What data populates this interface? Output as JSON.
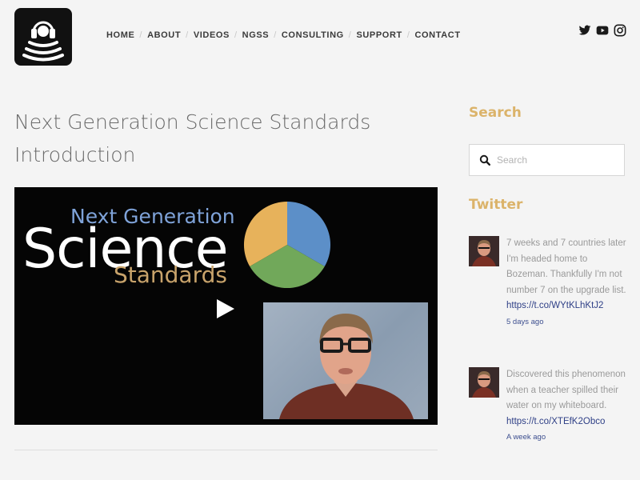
{
  "header": {
    "logo_icon": "headphones-signal-logo",
    "nav": [
      "HOME",
      "ABOUT",
      "VIDEOS",
      "NGSS",
      "CONSULTING",
      "SUPPORT",
      "CONTACT"
    ],
    "social_icons": [
      "twitter-icon",
      "youtube-icon",
      "instagram-icon"
    ]
  },
  "main": {
    "title": "Next Generation Science Standards Introduction",
    "video": {
      "line1": "Next Generation",
      "line2": "Science",
      "line3": "Standards",
      "pie_colors": [
        "#e7b25b",
        "#5c8fc8",
        "#71a85a"
      ]
    }
  },
  "sidebar": {
    "search_heading": "Search",
    "search_placeholder": "Search",
    "twitter_heading": "Twitter",
    "tweets": [
      {
        "text": "7 weeks and 7 countries later I'm headed home to Bozeman. Thankfully I'm not number 7 on the upgrade list.",
        "link": "https://t.co/WYtKLhKtJ2",
        "age": "5 days ago"
      },
      {
        "text": "Discovered this phenomenon when a teacher spilled their water on my whiteboard.",
        "link": "https://t.co/XTEfK2Obco",
        "age": "A week ago"
      }
    ]
  },
  "colors": {
    "accent": "#dbb36a",
    "link": "#2e3f86",
    "background": "#f4f4f4"
  }
}
